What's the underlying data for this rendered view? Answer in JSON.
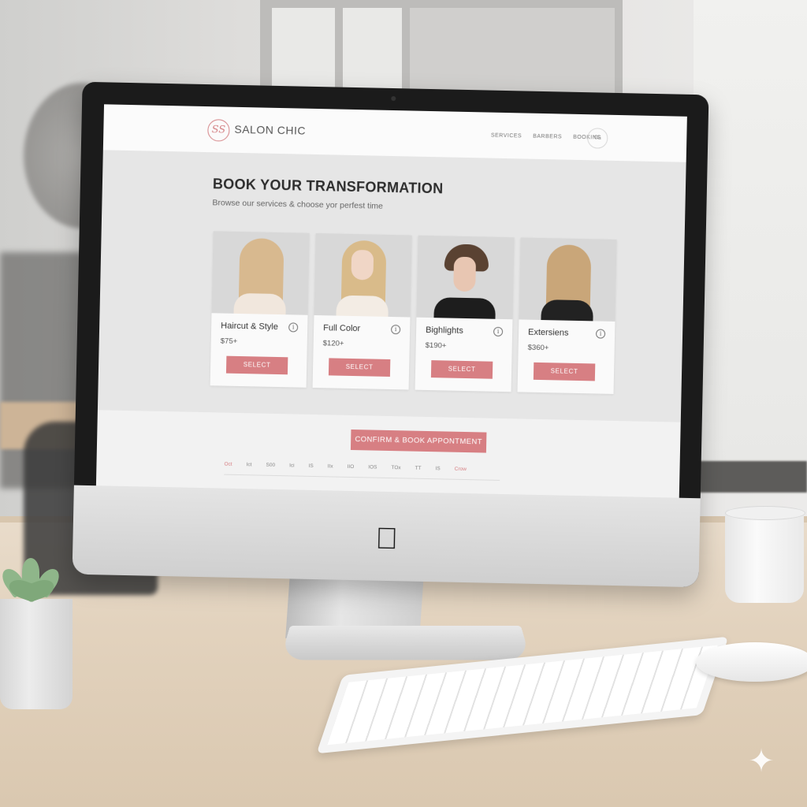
{
  "app": {
    "brand_name": "SALON CHIC",
    "logo_monogram": "SS",
    "nav": [
      "SERVICES",
      "BARBERS",
      "BOOKING"
    ],
    "nav_circle_label": "CL"
  },
  "hero": {
    "title": "BOOK YOUR TRANSFORMATION",
    "subtitle": "Browse our services & choose yor perfest time"
  },
  "services": [
    {
      "name": "Haircut & Style",
      "price": "$75+",
      "select_label": "SELECT",
      "hair_color": "#d8b98f",
      "torso_color": "#f1e7dd"
    },
    {
      "name": "Full Color",
      "price": "$120+",
      "select_label": "SELECT",
      "hair_color": "#d9bb8a",
      "torso_color": "#f3ece4"
    },
    {
      "name": "Bighlights",
      "price": "$190+",
      "select_label": "SELECT",
      "hair_color": "#5a4232",
      "torso_color": "#1d1d1d"
    },
    {
      "name": "Extersiens",
      "price": "$360+",
      "select_label": "SELECT",
      "hair_color": "#c9a679",
      "torso_color": "#222222"
    }
  ],
  "cta": {
    "label": "CONFIRM & BOOK APPONTMENT"
  },
  "time_slots": [
    "Oct",
    "Ict",
    "S00",
    "Ici",
    "IS",
    "IIx",
    "IIO",
    "IOS",
    "TOx",
    "TT",
    "IS",
    "Crow"
  ],
  "colors": {
    "accent": "#d77f83",
    "screen_bg": "#e6e6e6",
    "header_bg": "#fbfbfb"
  },
  "device": {
    "logo_icon": "apple-icon"
  },
  "watermark": {
    "icon": "sparkle-icon"
  }
}
